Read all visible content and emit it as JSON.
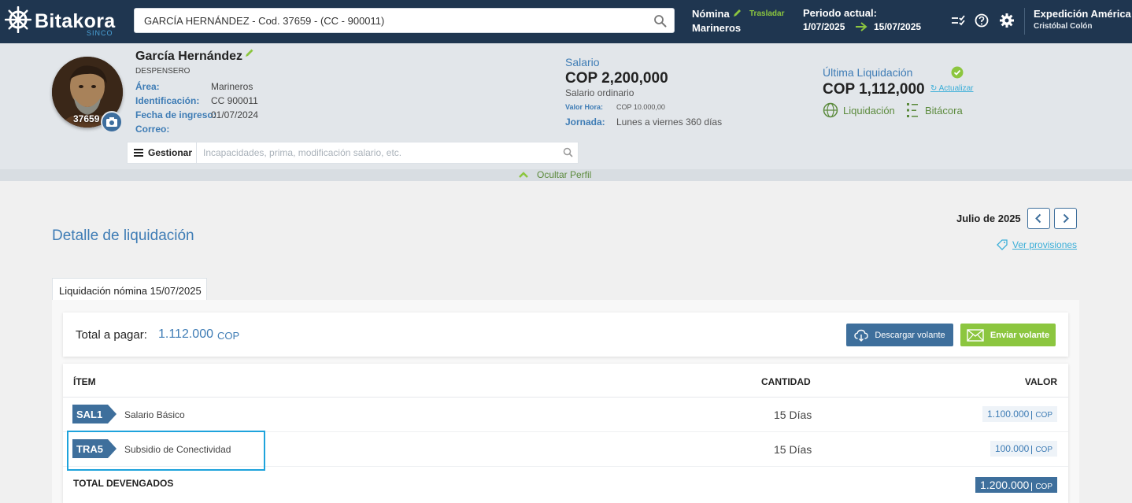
{
  "header": {
    "logo_text": "Bitakora",
    "logo_sub": "SINCO",
    "search_value": "GARCÍA HERNÁNDEZ - Cod. 37659 - (CC - 900011)",
    "nomina_label": "Nómina",
    "trasladar_label": "Trasladar",
    "nomina_value": "Marineros",
    "periodo_label": "Periodo actual:",
    "periodo_from": "1/07/2025",
    "periodo_to": "15/07/2025",
    "company": "Expedición América",
    "user": "Cristóbal Colón"
  },
  "profile": {
    "code": "37659",
    "name": "García Hernández",
    "role": "DESPENSERO",
    "fields": [
      {
        "label": "Área:",
        "value": "Marineros"
      },
      {
        "label": "Identificación:",
        "value": "CC 900011"
      },
      {
        "label": "Fecha de ingreso:",
        "value": "01/07/2024"
      },
      {
        "label": "Correo:",
        "value": ""
      }
    ],
    "salario_label": "Salario",
    "salario_value": "COP 2,200,000",
    "salario_type": "Salario ordinario",
    "valor_hora_label": "Valor Hora:",
    "valor_hora_value": "COP 10.000,00",
    "jornada_label": "Jornada:",
    "jornada_value": "Lunes a viernes 360 días",
    "ultima_label": "Última Liquidación",
    "ultima_value": "COP 1,112,000",
    "actualizar": "Actualizar",
    "liquidacion_link": "Liquidación",
    "bitacora_link": "Bitácora",
    "gestionar_label": "Gestionar",
    "gestionar_placeholder": "Incapacidades, prima, modificación salario, etc.",
    "ocultar_label": "Ocultar Perfil"
  },
  "main": {
    "month": "Julio de 2025",
    "title": "Detalle de liquidación",
    "ver_provisiones": "Ver provisiones",
    "tab_label": "Liquidación nómina 15/07/2025",
    "total_label": "Total a pagar:",
    "total_value": "1.112.000",
    "total_currency": "COP",
    "descargar_label": "Descargar volante",
    "enviar_label": "Enviar volante",
    "columns": {
      "item": "ÍTEM",
      "cantidad": "CANTIDAD",
      "valor": "VALOR"
    },
    "rows": [
      {
        "code": "SAL1",
        "desc": "Salario Básico",
        "qty": "15 Días",
        "value": "1.100.000",
        "currency": "COP"
      },
      {
        "code": "TRA5",
        "desc": "Subsidio de Conectividad",
        "qty": "15 Días",
        "value": "100.000",
        "currency": "COP"
      }
    ],
    "total_dev_label": "TOTAL DEVENGADOS",
    "total_dev_value": "1.200.000",
    "total_dev_currency": "COP"
  },
  "colors": {
    "header_bg": "#1f3650",
    "accent_blue": "#3e7cb5",
    "button_blue": "#3e6f9c",
    "accent_green": "#8cc63f",
    "highlight": "#1ea3dc"
  }
}
